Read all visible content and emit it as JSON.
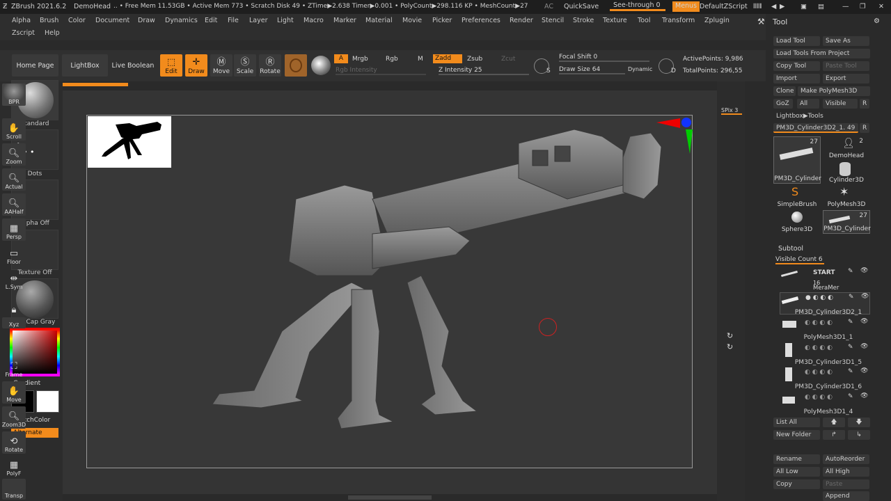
{
  "titlebar": {
    "app": "ZBrush 2021.6.2",
    "project": "DemoHead",
    "stats": ".. • Free Mem 11.53GB • Active Mem 773 • Scratch Disk 49 • ZTime▶2.638 Timer▶0.001 • PolyCount▶298.116 KP • MeshCount▶27",
    "ac": "AC",
    "quicksave": "QuickSave",
    "seethrough": "See-through  0",
    "menus": "Menus",
    "script": "DefaultZScript"
  },
  "menu": [
    "Alpha",
    "Brush",
    "Color",
    "Document",
    "Draw",
    "Dynamics",
    "Edit",
    "File",
    "Layer",
    "Light",
    "Macro",
    "Marker",
    "Material",
    "Movie",
    "Picker",
    "Preferences",
    "Render",
    "Stencil",
    "Stroke",
    "Texture",
    "Tool",
    "Transform",
    "Zplugin"
  ],
  "menu2": [
    "Zscript",
    "Help"
  ],
  "shelf": {
    "home": "Home Page",
    "lightbox": "LightBox",
    "liveboolean": "Live Boolean",
    "edit": "Edit",
    "draw": "Draw",
    "move": "Move",
    "scale": "Scale",
    "rotate": "Rotate",
    "a": "A",
    "mrgb": "Mrgb",
    "rgb": "Rgb",
    "m": "M",
    "zadd": "Zadd",
    "zsub": "Zsub",
    "zcut": "Zcut",
    "rgbintensity": "Rgb Intensity",
    "zintensity_label": "Z Intensity",
    "zintensity": "25",
    "focal_label": "Focal Shift",
    "focal": "0",
    "drawsize_label": "Draw Size",
    "drawsize": "64",
    "dynamic": "Dynamic",
    "activepoints": "ActivePoints: 9,986",
    "totalpoints": "TotalPoints: 296,55",
    "s": "S",
    "d": "D"
  },
  "left": {
    "standard": "Standard",
    "dots": "Dots",
    "alpha": "Alpha Off",
    "texture": "Texture Off",
    "matcap": "MatCap Gray",
    "gradient": "Gradient",
    "switchcolor": "SwitchColor",
    "alternate": "Alternate"
  },
  "right": [
    "BPR",
    "SPix 3",
    "Scroll",
    "Zoom",
    "Actual",
    "AAHalf",
    "Persp",
    "Floor",
    "L.Sym",
    "",
    "Xyz",
    "",
    "",
    "Frame",
    "Move",
    "Zoom3D",
    "Rotate",
    "PolyF",
    "Transp"
  ],
  "tool": {
    "title": "Tool",
    "load": "Load Tool",
    "saveas": "Save As",
    "loadproject": "Load Tools From Project",
    "copytool": "Copy Tool",
    "pastetool": "Paste Tool",
    "import": "Import",
    "export": "Export",
    "clone": "Clone",
    "makepoly": "Make PolyMesh3D",
    "goz": "GoZ",
    "all": "All",
    "visible": "Visible",
    "r": "R",
    "lightboxtools": "Lightbox▶Tools",
    "current": "PM3D_Cylinder3D2_1. 49",
    "thumbs": [
      {
        "label": "PM3D_Cylinder",
        "count": "27"
      },
      {
        "label": "DemoHead",
        "count": "2"
      },
      {
        "label": "Cylinder3D",
        "count": ""
      },
      {
        "label": "SimpleBrush",
        "count": ""
      },
      {
        "label": "PolyMesh3D",
        "count": ""
      },
      {
        "label": "Sphere3D",
        "count": ""
      },
      {
        "label": "PM3D_Cylinder",
        "count": "27"
      }
    ],
    "subtool": "Subtool",
    "visiblecount": "Visible Count 6",
    "start": "START",
    "startnum": "16",
    "megamet": "MeraMer",
    "subtools": [
      "PM3D_Cylinder3D2_1",
      "PolyMesh3D1_1",
      "PM3D_Cylinder3D1_5",
      "PM3D_Cylinder3D1_6",
      "PolyMesh3D1_4"
    ],
    "listall": "List All",
    "newfolder": "New Folder",
    "rename": "Rename",
    "autoreorder": "AutoReorder",
    "alllow": "All Low",
    "allhigh": "All High",
    "copy": "Copy",
    "paste": "Paste",
    "append": "Append"
  },
  "colors": {
    "accent": "#f28b1c",
    "bg": "#2a2a2a",
    "canvas": "#383838"
  }
}
